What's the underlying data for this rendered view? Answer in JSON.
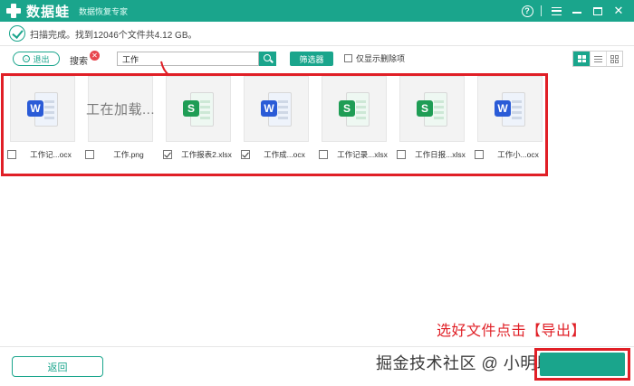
{
  "titlebar": {
    "app_name": "数据蛙",
    "subtitle": "数据恢复专家",
    "icons": [
      "help-icon",
      "menu-icon",
      "minimize-icon",
      "maximize-icon",
      "close-icon"
    ],
    "help_glyph": "?",
    "close_glyph": "✕"
  },
  "status": {
    "text": "扫描完成。找到12046个文件共4.12 GB。"
  },
  "toolbar": {
    "exit_label": "退出",
    "search_label": "搜索",
    "search_value": "工作",
    "filter_label": "筛选器",
    "deleted_only_label": "仅显示删除项",
    "clear_glyph": "✕"
  },
  "files": [
    {
      "name": "工作记...ocx",
      "type": "word",
      "badge": "W",
      "checked": false
    },
    {
      "name": "工作.png",
      "type": "image-loading",
      "badge": "",
      "loading_text": "工在加载...",
      "checked": false
    },
    {
      "name": "工作报表2.xlsx",
      "type": "excel",
      "badge": "S",
      "checked": true
    },
    {
      "name": "工作成...ocx",
      "type": "word",
      "badge": "W",
      "checked": true
    },
    {
      "name": "工作记录...xlsx",
      "type": "excel",
      "badge": "S",
      "checked": false
    },
    {
      "name": "工作日报...xlsx",
      "type": "excel",
      "badge": "S",
      "checked": false
    },
    {
      "name": "工作小...ocx",
      "type": "word",
      "badge": "W",
      "checked": false
    }
  ],
  "annotation": {
    "text": "选好文件点击【导出】",
    "color": "#e01f26"
  },
  "footer": {
    "back_label": "返回",
    "watermark": "掘金技术社区 @ 小明助手"
  },
  "colors": {
    "accent": "#1aa58c",
    "highlight": "#e01f26",
    "word": "#2a5bd7",
    "excel": "#1f9d55"
  }
}
